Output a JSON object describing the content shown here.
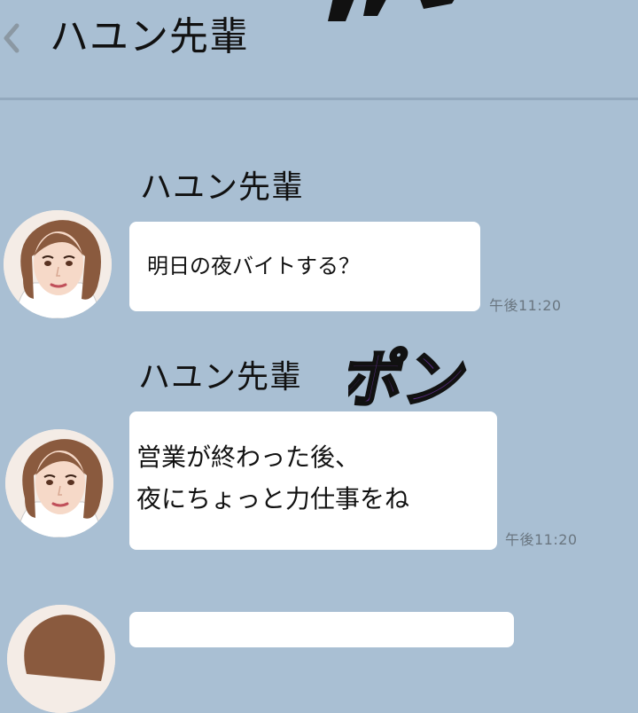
{
  "header": {
    "title": "ハユン先輩",
    "back_icon": "chevron-left-icon"
  },
  "messages": [
    {
      "sender": "ハユン先輩",
      "text": "明日の夜バイトする？",
      "time": "午後11:20"
    },
    {
      "sender": "ハユン先輩",
      "text": "営業が終わった後、\n夜にちょっと力仕事をね",
      "time": "午後11:20"
    }
  ],
  "sound_effects": {
    "main": "ポン"
  },
  "colors": {
    "background": "#a9bfd3",
    "bubble": "#ffffff",
    "sfx": "#5b2c86"
  }
}
